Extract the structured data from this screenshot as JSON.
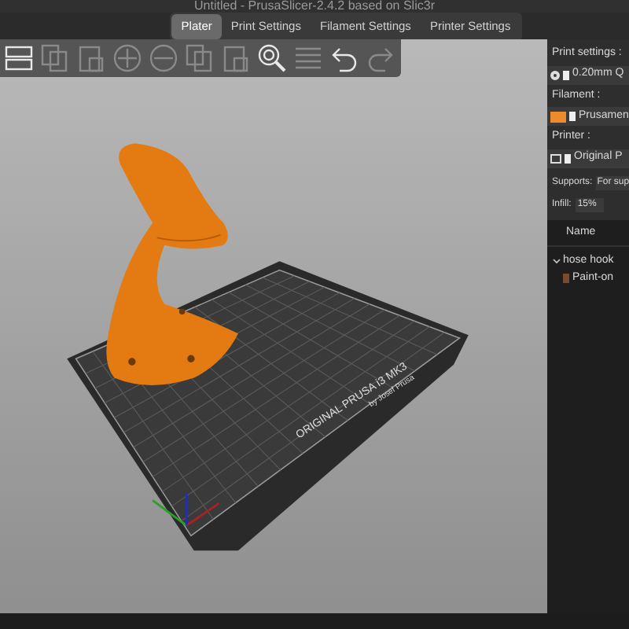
{
  "window": {
    "title": "Untitled - PrusaSlicer-2.4.2 based on Slic3r"
  },
  "tabs": [
    {
      "label": "Plater",
      "selected": true
    },
    {
      "label": "Print Settings",
      "selected": false
    },
    {
      "label": "Filament Settings",
      "selected": false
    },
    {
      "label": "Printer Settings",
      "selected": false
    }
  ],
  "toolbar": [
    {
      "kind": "grid",
      "disabled": false
    },
    {
      "kind": "copy",
      "disabled": true
    },
    {
      "kind": "paste",
      "disabled": true
    },
    {
      "kind": "plus",
      "disabled": true
    },
    {
      "kind": "minus",
      "disabled": true
    },
    {
      "kind": "copy",
      "disabled": true
    },
    {
      "kind": "paste",
      "disabled": true
    },
    {
      "kind": "search",
      "disabled": false
    },
    {
      "kind": "layers",
      "disabled": true
    },
    {
      "kind": "undo",
      "disabled": false
    },
    {
      "kind": "redo",
      "disabled": true
    }
  ],
  "bed": {
    "label": "ORIGINAL PRUSA i3 MK3",
    "sublabel": "by Josef Prusa"
  },
  "sidebar": {
    "print_settings": {
      "label": "Print settings :",
      "value": "0.20mm Q"
    },
    "filament": {
      "label": "Filament :",
      "value": "Prusamen",
      "color": "#ed8a2c"
    },
    "printer": {
      "label": "Printer :",
      "value": "Original P"
    },
    "supports": {
      "label": "Supports:",
      "value": "For sup"
    },
    "infill": {
      "label": "Infill:",
      "value": "15%"
    },
    "object_list": {
      "column": "Name",
      "items": [
        {
          "name": "hose hook",
          "expanded": true,
          "children": [
            {
              "name": "Paint-on"
            }
          ]
        }
      ]
    }
  }
}
